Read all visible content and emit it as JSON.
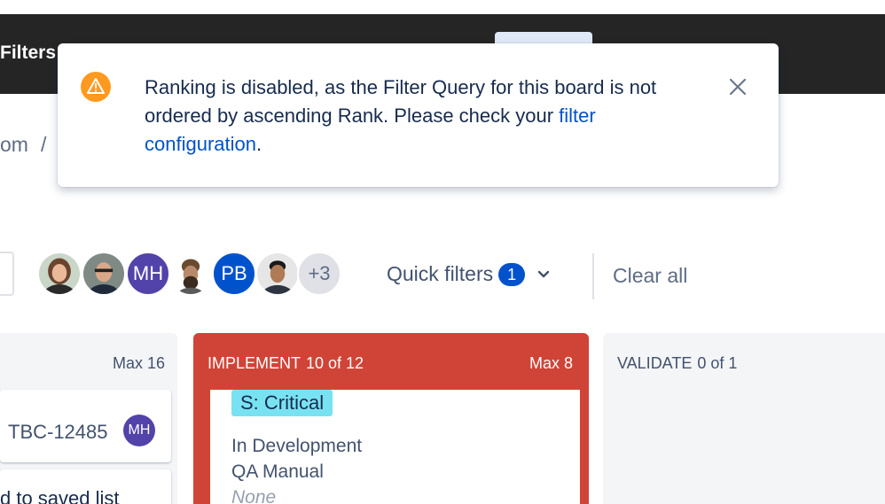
{
  "topbar": {
    "filters_label": "Filters"
  },
  "breadcrumb": {
    "crumb": "om",
    "separator": "/"
  },
  "flag": {
    "message_part1": "Ranking is disabled, as the Filter Query for this board is not ordered by ascending Rank. Please check your ",
    "link_text": "filter configuration",
    "message_end": ".",
    "icon": "warning-icon",
    "close_icon": "close-icon",
    "warning_color": "#ff991f"
  },
  "avatars": [
    {
      "type": "photo",
      "icon": "avatar-photo"
    },
    {
      "type": "photo",
      "icon": "avatar-photo"
    },
    {
      "type": "initials",
      "text": "MH"
    },
    {
      "type": "photo",
      "icon": "avatar-photo"
    },
    {
      "type": "initials",
      "text": "PB"
    },
    {
      "type": "photo",
      "icon": "avatar-photo"
    },
    {
      "type": "more",
      "text": "+3"
    }
  ],
  "quick_filters": {
    "label": "Quick filters",
    "count": "1"
  },
  "clear_all": "Clear all",
  "columns": {
    "left": {
      "max": "Max 16",
      "card_key": "TBC-12485",
      "card_assignee": "MH",
      "card2_text": "d to saved list"
    },
    "implement": {
      "name": "IMPLEMENT",
      "count": "10 of 12",
      "max": "Max 8",
      "color": "#d04437",
      "card": {
        "label": "S: Critical",
        "status": "In Development",
        "qa": "QA Manual",
        "none": "None"
      }
    },
    "validate": {
      "name": "VALIDATE",
      "count": "0 of 1"
    }
  }
}
